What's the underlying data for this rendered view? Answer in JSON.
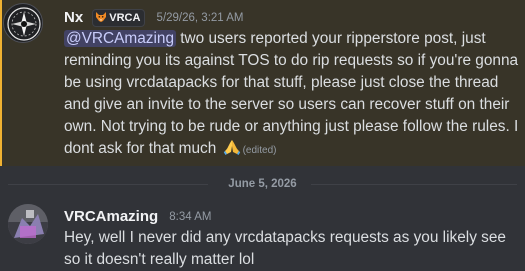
{
  "messages": [
    {
      "username": "Nx",
      "tag": {
        "icon": "fox-icon",
        "label": "VRCA"
      },
      "timestamp": "5/29/26, 3:21 AM",
      "mention": "@VRCAmazing",
      "text": " two users reported your ripperstore post, just reminding you its against TOS to do rip requests so if you're gonna be using vrcdatapacks for that stuff, please just close the thread and give an invite to the server so users can recover stuff on their own. Not trying to be rude or anything just please follow the rules. I dont ask for that much ",
      "emoji": "folded-hands-emoji",
      "edited": "(edited)",
      "highlight_color": "#f0b232"
    },
    {
      "username": "VRCAmazing",
      "timestamp": "8:34 AM",
      "text": "Hey, well I never did any vrcdatapacks requests as you likely see so it doesn't really matter lol"
    }
  ],
  "date_divider": "June 5, 2026"
}
